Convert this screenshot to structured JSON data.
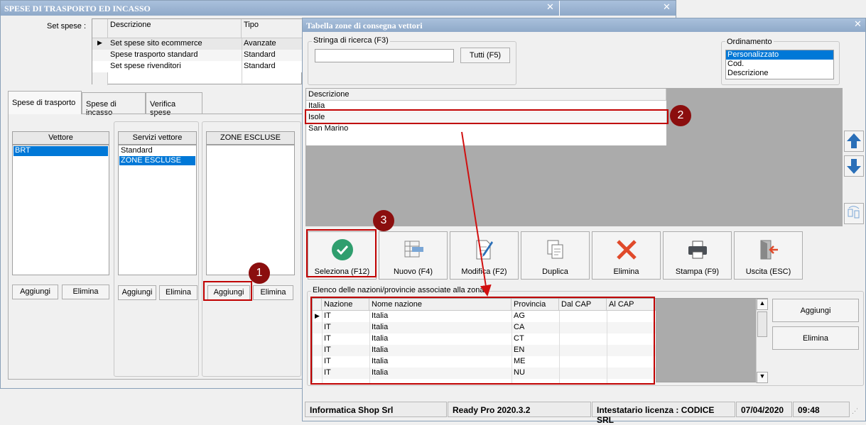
{
  "main_window": {
    "title": "SPESE DI TRASPORTO ED INCASSO",
    "set_spese_label": "Set spese :",
    "set_spese_table": {
      "columns": [
        "Descrizione",
        "Tipo"
      ],
      "rows": [
        {
          "descrizione": "Set spese sito ecommerce",
          "tipo": "Avanzate",
          "current": true
        },
        {
          "descrizione": "Spese trasporto standard",
          "tipo": "Standard"
        },
        {
          "descrizione": "Set spese rivenditori",
          "tipo": "Standard"
        }
      ]
    },
    "tabs": [
      {
        "label": "Spese di trasporto",
        "active": true
      },
      {
        "label": "Spese di incasso"
      },
      {
        "label": "Verifica spese"
      }
    ],
    "vettore": {
      "header": "Vettore",
      "items": [
        "BRT"
      ],
      "add_label": "Aggiungi",
      "delete_label": "Elimina"
    },
    "servizi": {
      "header": "Servizi vettore",
      "items": [
        "Standard",
        "ZONE ESCLUSE"
      ],
      "add_label": "Aggiungi",
      "delete_label": "Elimina"
    },
    "zone": {
      "header": "ZONE ESCLUSE",
      "items": [],
      "add_label": "Aggiungi",
      "delete_label": "Elimina"
    }
  },
  "dialog": {
    "title": "Tabella zone di consegna vettori",
    "search": {
      "label": "Stringa di ricerca (F3)",
      "value": "",
      "all_button": "Tutti (F5)"
    },
    "ordering": {
      "label": "Ordinamento",
      "options": [
        "Personalizzato",
        "Cod.",
        "Descrizione"
      ],
      "selected": "Personalizzato"
    },
    "zones_table": {
      "header": "Descrizione",
      "rows": [
        "Italia",
        "Isole",
        "San Marino"
      ],
      "selected": "Isole"
    },
    "toolbar": {
      "select": "Seleziona (F12)",
      "new": "Nuovo (F4)",
      "edit": "Modifica (F2)",
      "duplicate": "Duplica",
      "delete": "Elimina",
      "print": "Stampa (F9)",
      "exit": "Uscita (ESC)"
    },
    "nations_group": {
      "label": "Elenco delle nazioni/provincie associate alla zona",
      "columns": [
        "Nazione",
        "Nome nazione",
        "Provincia",
        "Dal CAP",
        "Al CAP"
      ],
      "rows": [
        {
          "nazione": "IT",
          "nome": "Italia",
          "provincia": "AG",
          "dal": "",
          "al": ""
        },
        {
          "nazione": "IT",
          "nome": "Italia",
          "provincia": "CA",
          "dal": "",
          "al": ""
        },
        {
          "nazione": "IT",
          "nome": "Italia",
          "provincia": "CT",
          "dal": "",
          "al": ""
        },
        {
          "nazione": "IT",
          "nome": "Italia",
          "provincia": "EN",
          "dal": "",
          "al": ""
        },
        {
          "nazione": "IT",
          "nome": "Italia",
          "provincia": "ME",
          "dal": "",
          "al": ""
        },
        {
          "nazione": "IT",
          "nome": "Italia",
          "provincia": "NU",
          "dal": "",
          "al": ""
        }
      ],
      "add_label": "Aggiungi",
      "delete_label": "Elimina"
    },
    "status": {
      "company": "Informatica Shop Srl",
      "version": "Ready Pro 2020.3.2",
      "license": "Intestatario licenza : CODICE SRL",
      "date": "07/04/2020",
      "time": "09:48"
    }
  },
  "annotations": {
    "badge1": "1",
    "badge2": "2",
    "badge3": "3"
  },
  "colors": {
    "accent": "#0078d7",
    "highlight": "#c00000",
    "badge": "#8b0e0e",
    "titlebar": "#9bb4d2"
  }
}
